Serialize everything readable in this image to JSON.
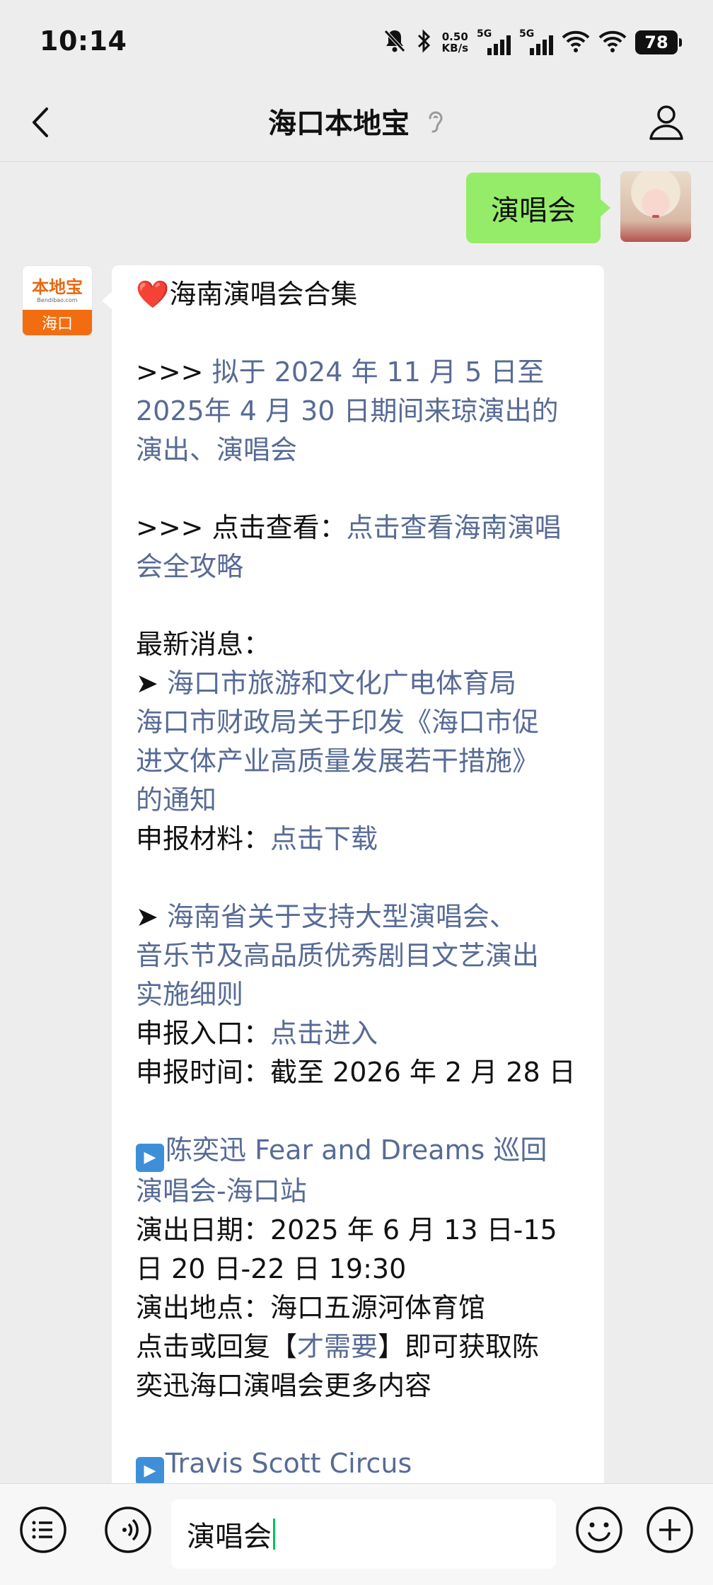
{
  "status": {
    "time": "10:14",
    "net_speed": "0.50",
    "net_unit": "KB/s",
    "sig1": "5G",
    "sig2": "5G",
    "battery": "78"
  },
  "header": {
    "title": "海口本地宝"
  },
  "me": {
    "message": "演唱会"
  },
  "bot": {
    "avatar_logo": "本地宝",
    "avatar_sub": "Bendibao.com",
    "avatar_city": "海口",
    "heart": "❤️",
    "title": "海南演唱会合集",
    "l1_prefix": ">>> ",
    "l1_link_a": "拟于 2024 年 11 月 5 日至",
    "l1_link_b": "2025年 4 月 30 日期间来琼演出的",
    "l1_link_c": "演出、演唱会",
    "l2_prefix": ">>> 点击查看：",
    "l2_link_a": "点击查看海南演唱",
    "l2_link_b": "会全攻略",
    "news_label": "最新消息：",
    "arrow": "➤ ",
    "n1_a": "海口市旅游和文化广电体育局",
    "n1_b": "海口市财政局关于印发《海口市促",
    "n1_c": "进文体产业高质量发展若干措施》",
    "n1_d": "的通知",
    "n1_mat_label": "申报材料：",
    "n1_mat_link": "点击下载",
    "n2_a": "海南省关于支持大型演唱会、",
    "n2_b": "音乐节及高品质优秀剧目文艺演出",
    "n2_c": "实施细则",
    "n2_entry_label": "申报入口：",
    "n2_entry_link": "点击进入",
    "n2_time": "申报时间：截至 2026 年 2 月 28 日",
    "c1_title_a": "陈奕迅 Fear and Dreams 巡回",
    "c1_title_b": "演唱会-海口站",
    "c1_date_a": "演出日期：2025 年 6 月 13 日-15",
    "c1_date_b": "日 20 日-22 日 19:30",
    "c1_venue": "演出地点：海口五源河体育馆",
    "c1_reply_pre": "点击或回复【",
    "c1_reply_link": "才需要",
    "c1_reply_post": "】即可获取陈",
    "c1_reply_end": "奕迅海口演唱会更多内容",
    "c2_title": "Travis Scott Circus"
  },
  "input": {
    "value": "演唱会"
  }
}
